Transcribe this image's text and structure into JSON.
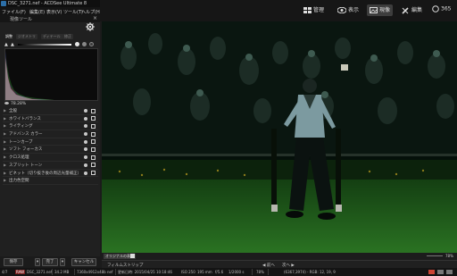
{
  "titlebar": {
    "title": "DSC_3271.nef - ACDSee Ultimate 8"
  },
  "menubar": {
    "items": [
      "ファイル(F)",
      "編集(E)",
      "表示(V)",
      "ツール(T)",
      "ヘルプ(H)"
    ]
  },
  "modes": [
    {
      "label": "管理",
      "icon": "manage-grid-icon",
      "active": false
    },
    {
      "label": "表示",
      "icon": "eye-icon",
      "active": false
    },
    {
      "label": "現像",
      "icon": "develop-icon",
      "active": true
    },
    {
      "label": "編集",
      "icon": "edit-brush-icon",
      "active": false
    },
    {
      "label": "365",
      "icon": "cloud-365-icon",
      "active": false
    }
  ],
  "left_panel": {
    "header": "現像ツール",
    "tabs": [
      "調整",
      "ジオメトリ",
      "ディテール",
      "修正"
    ],
    "zoom": "78.28%",
    "tools": [
      "全般",
      "ホワイトバランス",
      "ライティング",
      "アドバンス カラー",
      "トーンカーブ",
      "ソフト フォーカス",
      "クロス処理",
      "スプリット トーン",
      "ビネット（切り抜き後の周辺光量補正）",
      "出力色空間"
    ],
    "buttons": {
      "save": "保存",
      "done": "完了",
      "cancel": "キャンセル"
    }
  },
  "viewer_bar": {
    "original_label": "オリジナルの表示",
    "zoom_value": "78%"
  },
  "filmstrip": {
    "label": "フィルムストリップ",
    "prev": "前へ",
    "next": "次へ"
  },
  "status": {
    "index": "4/7",
    "filename": "DSC_3271.nef",
    "filesize": "34.2 MB",
    "dimensions": "7360x4912x48b nef",
    "modified": "更新日時: 2015/04/25 10:18:46",
    "iso": "ISO 250",
    "focal": "195 mm",
    "fstop": "f/5.6",
    "shutter": "1/2000 s",
    "zoom": "78%",
    "pixel": "(6367,3974) - RGB: 12, 19, 9"
  },
  "colors": {
    "accent_blue": "#3a83c7",
    "grass": "#1f5a1a",
    "panel_bg": "#202020"
  }
}
